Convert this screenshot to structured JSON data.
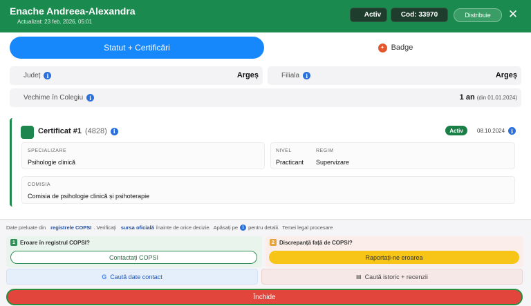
{
  "header": {
    "name": "Enache Andreea-Alexandra",
    "updated": "Actualizat: 23 feb. 2026, 05:01",
    "status": "Activ",
    "code": "Cod: 33970",
    "share": "Distribuie",
    "close_icon": "close-icon",
    "bg_color": "#1a8a4e"
  },
  "tabs": {
    "main": "Statut + Certificări",
    "badge": "Badge"
  },
  "fields": {
    "judet_label": "Județ",
    "judet_value": "Argeș",
    "filiala_label": "Filiala",
    "filiala_value": "Argeș",
    "vechime_label": "Vechime în Colegiu",
    "vechime_value": "1 an",
    "vechime_since": "(din 01.01.2024)"
  },
  "certificate": {
    "title": "Certificat #1",
    "number": "(4828)",
    "status": "Activ",
    "date": "08.10.2024",
    "specializare_label": "SPECIALIZARE",
    "specializare_value": "Psihologie clinică",
    "nivel_label": "NIVEL",
    "nivel_value": "Practicant",
    "regim_label": "REGIM",
    "regim_value": "Supervizare",
    "comisia_label": "COMISIA",
    "comisia_value": "Comisia de psihologie clinică și psihoterapie"
  },
  "footer": {
    "d1": "Date preluate din",
    "d_link1": "registrele COPSI",
    "d2": ". Verificați",
    "d_link2": "sursa oficială",
    "d3": "înainte de orice decizie.",
    "d4": "Apăsați pe",
    "d5": "pentru detalii.",
    "d6": "Temei legal procesare",
    "q1_num": "1",
    "q1_title": "Eroare în registrul COPSI?",
    "q1_button": "Contactați COPSI",
    "q2_num": "2",
    "q2_title": "Discrepanță față de COPSI?",
    "q2_button": "Raportați-ne eroarea",
    "search_contact": "Caută date contact",
    "search_history": "Caută istoric + recenzii",
    "close": "Închide"
  }
}
